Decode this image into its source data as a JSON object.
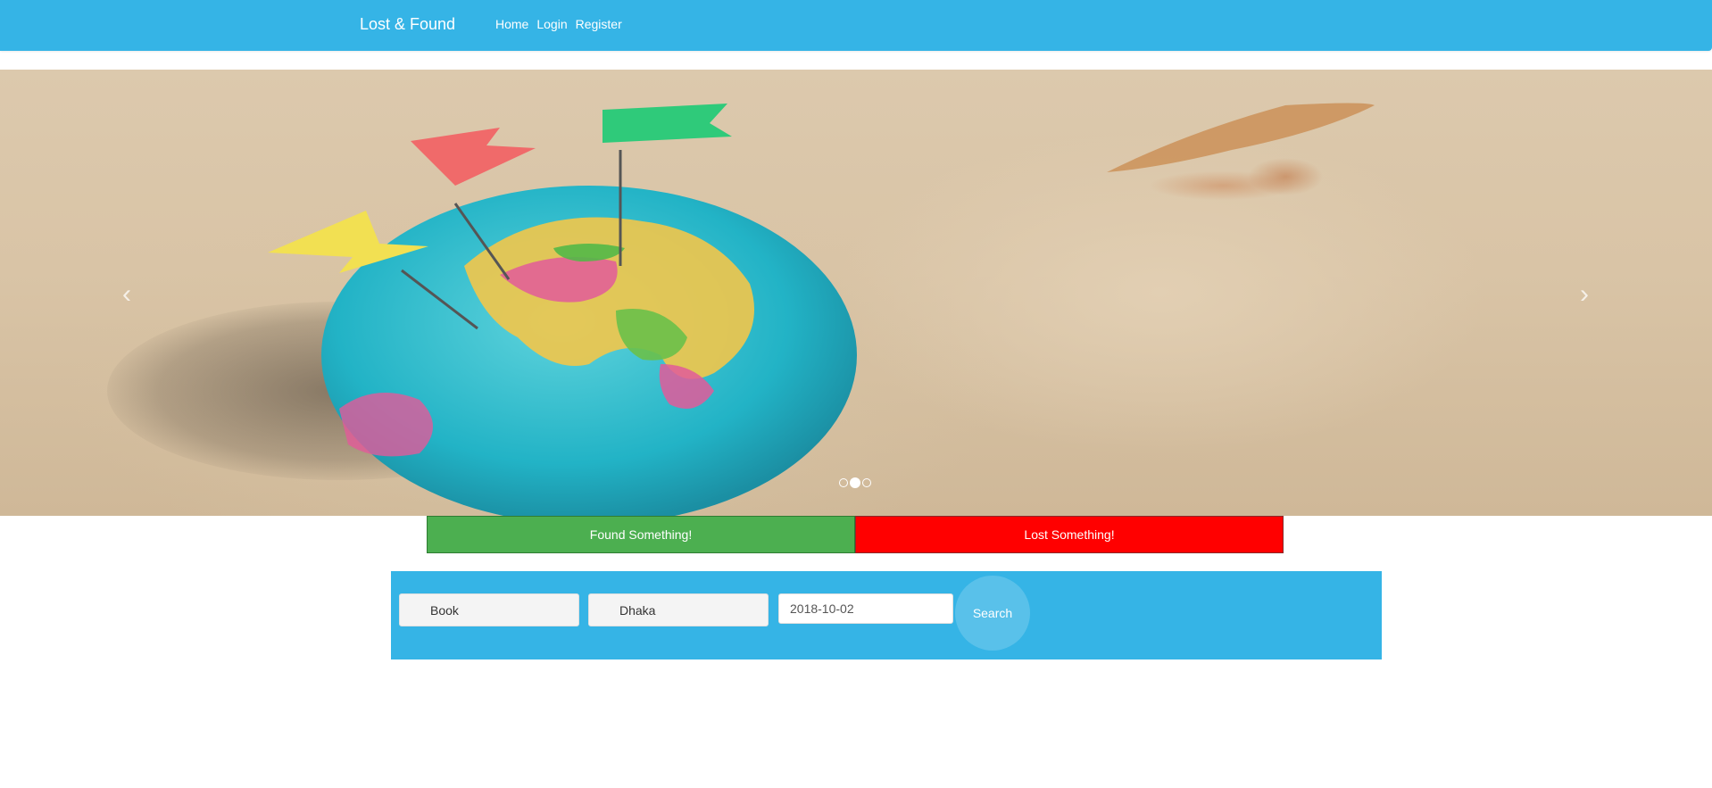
{
  "navbar": {
    "brand": "Lost & Found",
    "links": [
      {
        "label": "Home"
      },
      {
        "label": "Login"
      },
      {
        "label": "Register"
      }
    ]
  },
  "carousel": {
    "prev_glyph": "‹",
    "next_glyph": "›",
    "slide_count": 3,
    "active_slide": 2
  },
  "actions": {
    "found_label": "Found Something!",
    "lost_label": "Lost Something!"
  },
  "search": {
    "item_value": "Book",
    "place_value": "Dhaka",
    "date_value": "2018-10-02",
    "button_label": "Search"
  },
  "colors": {
    "primary": "#35b4e6",
    "found": "#4caf50",
    "lost": "#ff0000"
  }
}
